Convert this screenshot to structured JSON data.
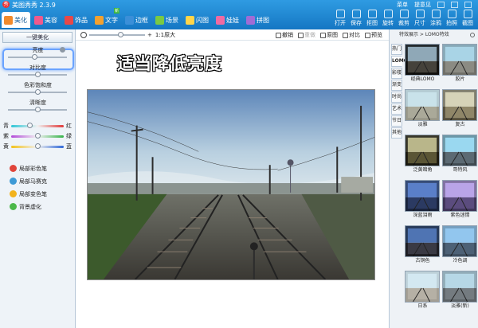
{
  "app": {
    "title": "美图秀秀 2.3.9",
    "logo_text": "秀"
  },
  "title_right": {
    "menu": "菜单",
    "feedback": "提意见"
  },
  "tabs": [
    {
      "label": "美化",
      "color": "#f28a2b",
      "active": true
    },
    {
      "label": "美容",
      "color": "#ef5a8c",
      "active": false
    },
    {
      "label": "饰品",
      "color": "#e84848",
      "active": false
    },
    {
      "label": "文字",
      "color": "#f3a12f",
      "active": false,
      "badge": "新"
    },
    {
      "label": "边框",
      "color": "#3b8fd8",
      "active": false
    },
    {
      "label": "场景",
      "color": "#7ac943",
      "active": false
    },
    {
      "label": "闪图",
      "color": "#ffd54a",
      "active": false
    },
    {
      "label": "娃娃",
      "color": "#f06aa2",
      "active": false
    },
    {
      "label": "拼图",
      "color": "#a06cd5",
      "active": false
    }
  ],
  "toolbar": [
    {
      "label": "打开",
      "icon": "folder-open-icon"
    },
    {
      "label": "保存",
      "icon": "save-icon"
    },
    {
      "label": "拒图",
      "icon": "image-icon"
    },
    {
      "label": "旋转",
      "icon": "rotate-icon"
    },
    {
      "label": "裁剪",
      "icon": "crop-icon"
    },
    {
      "label": "尺寸",
      "icon": "resize-icon"
    },
    {
      "label": "涂鸦",
      "icon": "brush-icon"
    },
    {
      "label": "拍照",
      "icon": "camera-icon"
    },
    {
      "label": "截图",
      "icon": "screenshot-icon"
    }
  ],
  "left": {
    "one_click": "一键美化",
    "sliders": [
      {
        "label": "亮度",
        "value": 0.45
      },
      {
        "label": "对比度",
        "value": 0.5
      },
      {
        "label": "色彩饱和度",
        "value": 0.5
      },
      {
        "label": "清晰度",
        "value": 0.5
      }
    ],
    "color_balance": [
      {
        "left": "青",
        "right": "红",
        "value": 0.35,
        "gradient": "linear-gradient(90deg,#2fc6d6,#f1f1f1,#e03a3a)"
      },
      {
        "left": "紫",
        "right": "绿",
        "value": 0.5,
        "gradient": "linear-gradient(90deg,#b34bd8,#f1f1f1,#37b34a)"
      },
      {
        "left": "黄",
        "right": "蓝",
        "value": 0.5,
        "gradient": "linear-gradient(90deg,#f2c21b,#f1f1f1,#2f68d8)"
      }
    ],
    "brushes": [
      {
        "label": "局部彩色笔",
        "color": "#e0443a"
      },
      {
        "label": "局部马赛克",
        "color": "#3d9ad6"
      },
      {
        "label": "局部变色笔",
        "color": "#f2b21b"
      },
      {
        "label": "背景虚化",
        "color": "#4cb84a"
      }
    ]
  },
  "center": {
    "zoom_value": 0.55,
    "zoom_text": "1:1原大",
    "actions": [
      {
        "label": "撤销",
        "disabled": false
      },
      {
        "label": "重做",
        "disabled": true
      },
      {
        "label": "原图",
        "disabled": false
      },
      {
        "label": "对比",
        "disabled": false
      },
      {
        "label": "预览",
        "disabled": false
      }
    ],
    "caption": "适当降低亮度"
  },
  "right": {
    "header": "特效展示 > LOMO特效",
    "vertical_tabs": [
      "热门",
      "LOMO",
      "影楼",
      "渐变",
      "时尚",
      "艺术",
      "节日",
      "其他"
    ],
    "active_tab": 1,
    "effects": [
      {
        "label": "经典LOMO",
        "sky": "#8fa8b7",
        "ground": "#45423b",
        "vignette": 0.75
      },
      {
        "label": "胶片",
        "sky": "#a9d4e6",
        "ground": "#8b8b83",
        "vignette": 0.2
      },
      {
        "label": "淡雅",
        "sky": "#c9e2ea",
        "ground": "#aaa999",
        "vignette": 0.1
      },
      {
        "label": "复古",
        "sky": "#d6d3b8",
        "ground": "#8f8668",
        "vignette": 0.4
      },
      {
        "label": "泛黄暗角",
        "sky": "#b9b68a",
        "ground": "#5a5535",
        "vignette": 0.7
      },
      {
        "label": "哥特风",
        "sky": "#9ad8f0",
        "ground": "#5c6a73",
        "vignette": 0.3
      },
      {
        "label": "深蓝泪雨",
        "sky": "#5a7fc9",
        "ground": "#2b3a62",
        "vignette": 0.4
      },
      {
        "label": "紫色迷情",
        "sky": "#b9a4e8",
        "ground": "#5b4c7e",
        "vignette": 0.3
      },
      {
        "label": "古铜色",
        "sky": "#4f74b3",
        "ground": "#3a3a44",
        "vignette": 0.5
      },
      {
        "label": "冷色调",
        "sky": "#92c6ee",
        "ground": "#4d6176",
        "vignette": 0.2
      },
      {
        "label": "日系",
        "sky": "#d3e8f1",
        "ground": "#b5b0a5",
        "vignette": 0.1
      },
      {
        "label": "淡雅(新)",
        "sky": "#b6d7e6",
        "ground": "#747b80",
        "vignette": 0.2
      }
    ]
  }
}
